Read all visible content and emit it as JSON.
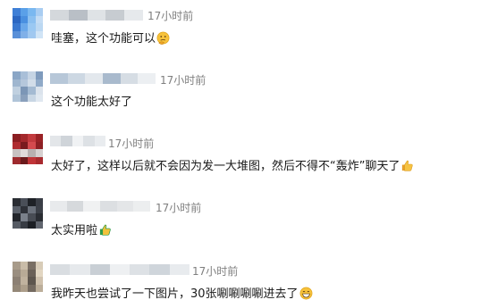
{
  "comments": [
    {
      "time": "17小时前",
      "text": "哇塞，这个功能可以",
      "emoji_icon": "thinking-face-emoji",
      "avatar_colors": [
        "#3f7fd6",
        "#5aa0e8",
        "#7ab8f0",
        "#a9cdf2",
        "#2c67c2",
        "#4a90e0",
        "#8cc0f0",
        "#c4dcf4",
        "#3a78cf",
        "#6aa8ea",
        "#9ac8f2",
        "#bcd8f2",
        "#5a90d8",
        "#80b0e8",
        "#a0c8f0",
        "#d0e4f6"
      ],
      "name_colors": [
        "#d4d8dc",
        "#b9bfc6",
        "#dfe3e6",
        "#c7ccd1",
        "#e6e9ec"
      ]
    },
    {
      "time": "17小时前",
      "text": "这个功能太好了",
      "emoji_icon": "",
      "avatar_colors": [
        "#8aa6c6",
        "#a9bfd8",
        "#c5d4e4",
        "#7f9bbd",
        "#9fb6cf",
        "#b5c7db",
        "#d2dde9",
        "#90aac8",
        "#c0d0e0",
        "#7c96b6",
        "#a4bad2",
        "#dbe3ec",
        "#b0c4d8",
        "#8aa0bc",
        "#c8d6e4",
        "#e0e8f0"
      ],
      "name_colors": [
        "#b7c7d8",
        "#cdd8e3",
        "#e3e8ed",
        "#a9bacd",
        "#d6dde4",
        "#eceff2"
      ]
    },
    {
      "time": "17小时前",
      "text": "太好了，这样以后就不会因为发一大堆图，然后不得不“轰炸”聊天了",
      "emoji_icon": "thumbs-up-emoji",
      "avatar_colors": [
        "#8b1e22",
        "#a3282c",
        "#c23a3e",
        "#9a2226",
        "#b02c30",
        "#7a1a1e",
        "#d44a4e",
        "#8e2024",
        "#c8c2c2",
        "#e0dada",
        "#b8b0b0",
        "#d6d0d0",
        "#9e2a2e",
        "#6a1a1c",
        "#c03438",
        "#a82a2e"
      ],
      "name_colors": [
        "#e3e6e9",
        "#cfd4d9",
        "#f0f2f4",
        "#dde1e5",
        "#e9ecef"
      ]
    },
    {
      "time": "17小时前",
      "text": "太实用啦",
      "emoji_icon": "thumbs-up-green-emoji",
      "avatar_colors": [
        "#2a2d33",
        "#4a4f58",
        "#1e2126",
        "#3a3e46",
        "#5a606a",
        "#2e3138",
        "#6a707a",
        "#3c4048",
        "#22252b",
        "#7a808a",
        "#484c54",
        "#2a2d33",
        "#565b64",
        "#383c44",
        "#1c1f24",
        "#60656e"
      ],
      "name_colors": [
        "#e8eaec",
        "#d6d9dc",
        "#f0f1f2",
        "#dcdfe2",
        "#e4e6e8",
        "#eceeef"
      ]
    },
    {
      "time": "17小时前",
      "text": "我昨天也尝试了一下图片，30张唰唰唰唰进去了",
      "emoji_icon": "grinning-face-emoji",
      "avatar_colors": [
        "#a89b8a",
        "#c9bca8",
        "#7a6f64",
        "#d8ccb8",
        "#9a8e80",
        "#b8aa96",
        "#6b6158",
        "#e2d6c2",
        "#8c8074",
        "#c0b29e",
        "#5e564e",
        "#d0c2ae",
        "#948878",
        "#ac9e8a",
        "#746a60",
        "#bcae9a"
      ],
      "name_colors": [
        "#d9dde1",
        "#e6e9ec",
        "#c9cfd5",
        "#eef0f2",
        "#dde1e5",
        "#cfd5db",
        "#e8ebee"
      ]
    }
  ]
}
